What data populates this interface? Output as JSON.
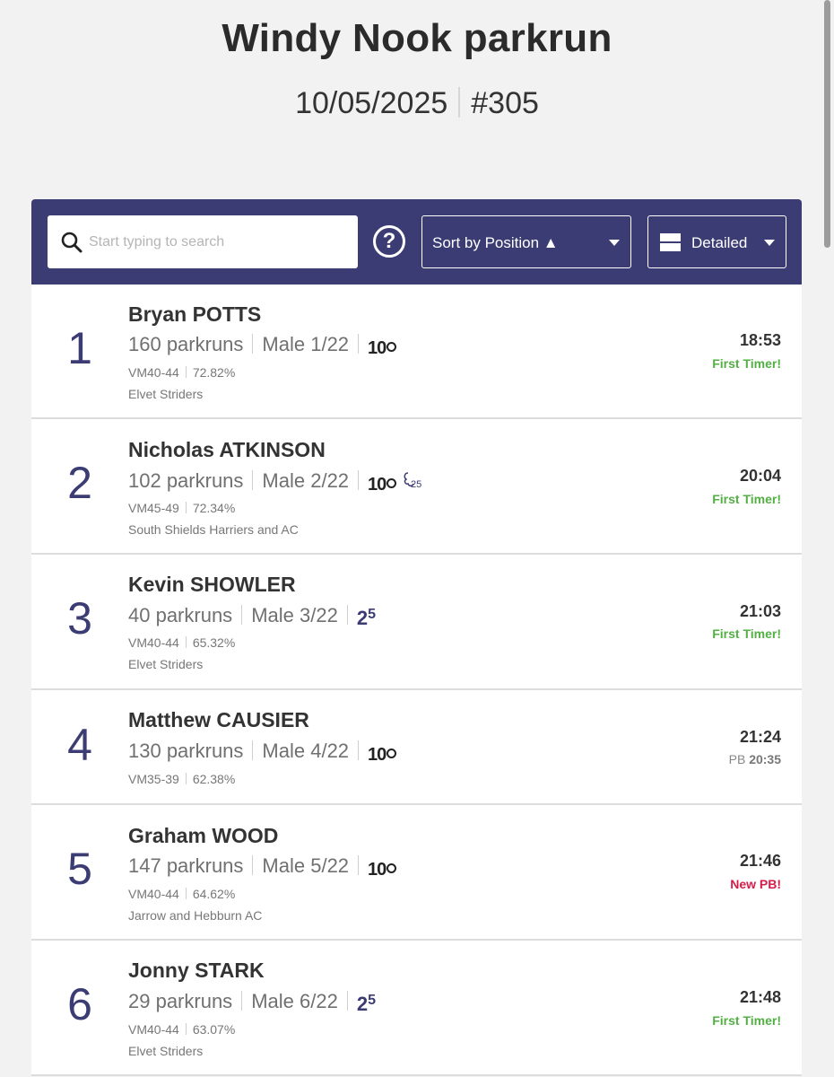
{
  "event": {
    "title": "Windy Nook parkrun",
    "date": "10/05/2025",
    "number": "#305"
  },
  "toolbar": {
    "search_placeholder": "Start typing to search",
    "help_label": "?",
    "sort_label": "Sort by Position ▲",
    "view_label": "Detailed"
  },
  "colors": {
    "toolbar_bg": "#3c3c75",
    "first_timer": "#52b043",
    "new_pb": "#d81c4a"
  },
  "results": [
    {
      "position": "1",
      "name": "Bryan POTTS",
      "parkruns": "160 parkruns",
      "gender_pos": "Male 1/22",
      "milestones": [
        "100"
      ],
      "age_cat": "VM40-44",
      "age_grade": "72.82%",
      "club": "Elvet Striders",
      "time": "18:53",
      "status": "First Timer!",
      "status_type": "first"
    },
    {
      "position": "2",
      "name": "Nicholas ATKINSON",
      "parkruns": "102 parkruns",
      "gender_pos": "Male 2/22",
      "milestones": [
        "100",
        "25v"
      ],
      "age_cat": "VM45-49",
      "age_grade": "72.34%",
      "club": "South Shields Harriers and AC",
      "time": "20:04",
      "status": "First Timer!",
      "status_type": "first"
    },
    {
      "position": "3",
      "name": "Kevin SHOWLER",
      "parkruns": "40 parkruns",
      "gender_pos": "Male 3/22",
      "milestones": [
        "25"
      ],
      "age_cat": "VM40-44",
      "age_grade": "65.32%",
      "club": "Elvet Striders",
      "time": "21:03",
      "status": "First Timer!",
      "status_type": "first"
    },
    {
      "position": "4",
      "name": "Matthew CAUSIER",
      "parkruns": "130 parkruns",
      "gender_pos": "Male 4/22",
      "milestones": [
        "100"
      ],
      "age_cat": "VM35-39",
      "age_grade": "62.38%",
      "club": "",
      "time": "21:24",
      "status_prefix": "PB",
      "status": "20:35",
      "status_type": "pb"
    },
    {
      "position": "5",
      "name": "Graham WOOD",
      "parkruns": "147 parkruns",
      "gender_pos": "Male 5/22",
      "milestones": [
        "100"
      ],
      "age_cat": "VM40-44",
      "age_grade": "64.62%",
      "club": "Jarrow and Hebburn AC",
      "time": "21:46",
      "status": "New PB!",
      "status_type": "new"
    },
    {
      "position": "6",
      "name": "Jonny STARK",
      "parkruns": "29 parkruns",
      "gender_pos": "Male 6/22",
      "milestones": [
        "25"
      ],
      "age_cat": "VM40-44",
      "age_grade": "63.07%",
      "club": "Elvet Striders",
      "time": "21:48",
      "status": "First Timer!",
      "status_type": "first"
    }
  ]
}
